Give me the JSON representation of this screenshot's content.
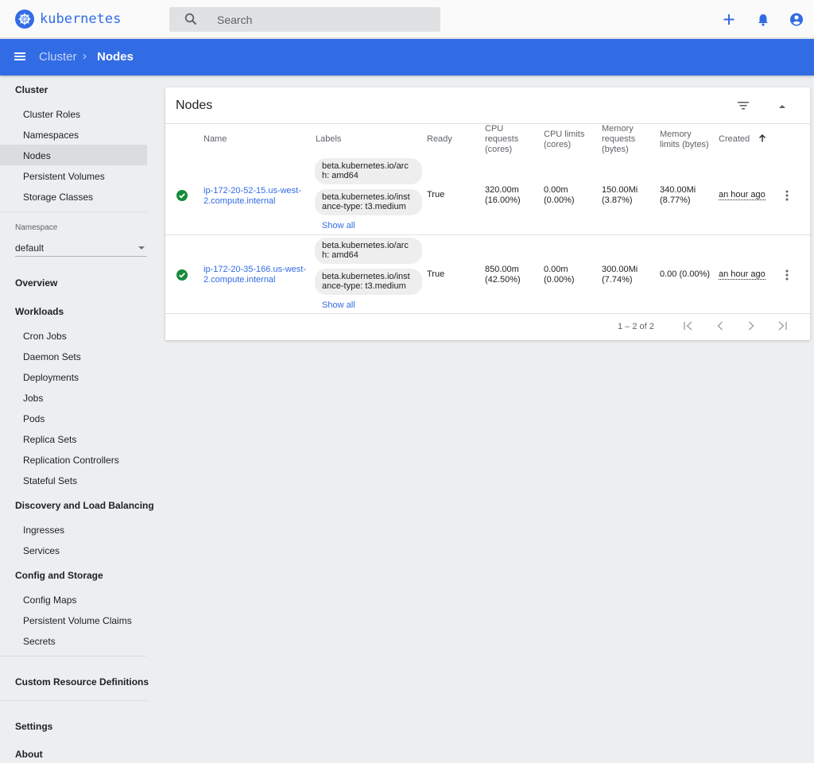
{
  "app": {
    "name": "kubernetes"
  },
  "search": {
    "placeholder": "Search"
  },
  "breadcrumb": {
    "parent": "Cluster",
    "current": "Nodes"
  },
  "sidebar": {
    "cluster_header": "Cluster",
    "cluster_items": [
      "Cluster Roles",
      "Namespaces",
      "Nodes",
      "Persistent Volumes",
      "Storage Classes"
    ],
    "selected": "Nodes",
    "namespace_label": "Namespace",
    "namespace_value": "default",
    "overview": "Overview",
    "workloads_header": "Workloads",
    "workloads_items": [
      "Cron Jobs",
      "Daemon Sets",
      "Deployments",
      "Jobs",
      "Pods",
      "Replica Sets",
      "Replication Controllers",
      "Stateful Sets"
    ],
    "discovery_header": "Discovery and Load Balancing",
    "discovery_items": [
      "Ingresses",
      "Services"
    ],
    "config_header": "Config and Storage",
    "config_items": [
      "Config Maps",
      "Persistent Volume Claims",
      "Secrets"
    ],
    "crd": "Custom Resource Definitions",
    "settings": "Settings",
    "about": "About"
  },
  "card": {
    "title": "Nodes",
    "columns": {
      "name": "Name",
      "labels": "Labels",
      "ready": "Ready",
      "cpu_requests": [
        "CPU",
        "requests",
        "(cores)"
      ],
      "cpu_limits": [
        "CPU limits",
        "(cores)"
      ],
      "mem_requests": [
        "Memory",
        "requests",
        "(bytes)"
      ],
      "mem_limits": [
        "Memory",
        "limits (bytes)"
      ],
      "created": "Created"
    },
    "rows": [
      {
        "name": [
          "ip-172-20-52-15.us-west-",
          "2.compute.internal"
        ],
        "label1": [
          "beta.kubernetes.io/arc",
          "h: amd64"
        ],
        "label2": [
          "beta.kubernetes.io/inst",
          "ance-type: t3.medium"
        ],
        "show_all": "Show all",
        "ready": "True",
        "cpu_requests": [
          "320.00m",
          "(16.00%)"
        ],
        "cpu_limits": [
          "0.00m",
          "(0.00%)"
        ],
        "mem_requests": [
          "150.00Mi",
          "(3.87%)"
        ],
        "mem_limits": [
          "340.00Mi",
          "(8.77%)"
        ],
        "created": "an hour ago"
      },
      {
        "name": [
          "ip-172-20-35-166.us-west-",
          "2.compute.internal"
        ],
        "label1": [
          "beta.kubernetes.io/arc",
          "h: amd64"
        ],
        "label2": [
          "beta.kubernetes.io/inst",
          "ance-type: t3.medium"
        ],
        "show_all": "Show all",
        "ready": "True",
        "cpu_requests": [
          "850.00m",
          "(42.50%)"
        ],
        "cpu_limits": [
          "0.00m",
          "(0.00%)"
        ],
        "mem_requests": [
          "300.00Mi",
          "(7.74%)"
        ],
        "mem_limits": [
          "0.00 (0.00%)"
        ],
        "created": "an hour ago"
      }
    ],
    "pagination": "1 – 2 of 2"
  },
  "colors": {
    "brand": "#326ce5",
    "ok": "#168b3a"
  },
  "icons": [
    "kubernetes-logo-icon",
    "search-icon",
    "plus-icon",
    "bell-icon",
    "account-icon",
    "menu-icon",
    "filter-icon",
    "chevron-up-icon",
    "check-circle-icon",
    "kebab-icon",
    "first-page-icon",
    "prev-page-icon",
    "next-page-icon",
    "last-page-icon",
    "arrow-up-icon"
  ]
}
